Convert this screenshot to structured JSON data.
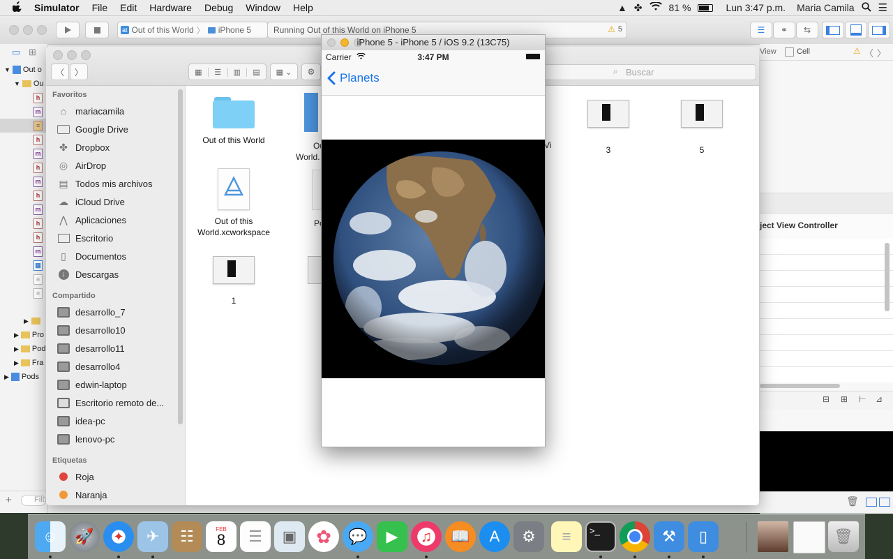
{
  "menubar": {
    "apple": "",
    "app_name": "Simulator",
    "menus": [
      "File",
      "Edit",
      "Hardware",
      "Debug",
      "Window",
      "Help"
    ],
    "battery": "81 %",
    "clock": "Lun 3:47 p.m.",
    "user": "Maria Camila"
  },
  "xcode": {
    "scheme_target": "Out of this World",
    "scheme_device": "iPhone 5",
    "activity_text": "Running Out of this World on iPhone 5",
    "warning_count": "5",
    "jump_view": "View",
    "jump_cell": "Cell",
    "inspector_title": "ject View Controller",
    "nav_rows": [
      "Out o",
      "Ou"
    ],
    "nav_groups": [
      "Pro",
      "Pod",
      "Fra",
      "Pods"
    ],
    "filter_placeholder": "Filt"
  },
  "finder": {
    "search_placeholder": "Buscar",
    "sections": {
      "favorites_title": "Favoritos",
      "favorites": [
        "mariacamila",
        "Google Drive",
        "Dropbox",
        "AirDrop",
        "Todos mis archivos",
        "iCloud Drive",
        "Aplicaciones",
        "Escritorio",
        "Documentos",
        "Descargas"
      ],
      "shared_title": "Compartido",
      "shared": [
        "desarrollo_7",
        "desarrollo10",
        "desarrollo11",
        "desarrollo4",
        "edwin-laptop",
        "Escritorio remoto de...",
        "idea-pc",
        "lenovo-pc"
      ],
      "tags_title": "Etiquetas",
      "tags": [
        {
          "label": "Roja",
          "color": "#e0443c"
        },
        {
          "label": "Naranja",
          "color": "#f09a37"
        }
      ]
    },
    "files": {
      "folder": "Out of this World",
      "project_partial_1": "Out",
      "project_partial_2": "World.",
      "workspace_1": "Out of this",
      "workspace_2": "World.xcworkspace",
      "partial_po": "Po",
      "partial_vi": "Vi",
      "shot_3": "3",
      "shot_5": "5",
      "shot_1": "1"
    }
  },
  "simulator": {
    "window_title": "iPhone 5 - iPhone 5 / iOS 9.2 (13C75)",
    "carrier": "Carrier",
    "time": "3:47 PM",
    "back_label": "Planets",
    "accent": "#1a73e8"
  },
  "dock": {
    "apps": [
      "finder",
      "launchpad",
      "safari",
      "mail",
      "contacts",
      "calendar",
      "reminders",
      "preview",
      "photos",
      "messages",
      "facetime",
      "itunes",
      "ibooks",
      "app-store",
      "system-preferences",
      "notes",
      "terminal",
      "chrome",
      "xcode",
      "simulator",
      "photo",
      "screenshot",
      "trash"
    ],
    "calendar_month": "FEB",
    "calendar_day": "8"
  }
}
